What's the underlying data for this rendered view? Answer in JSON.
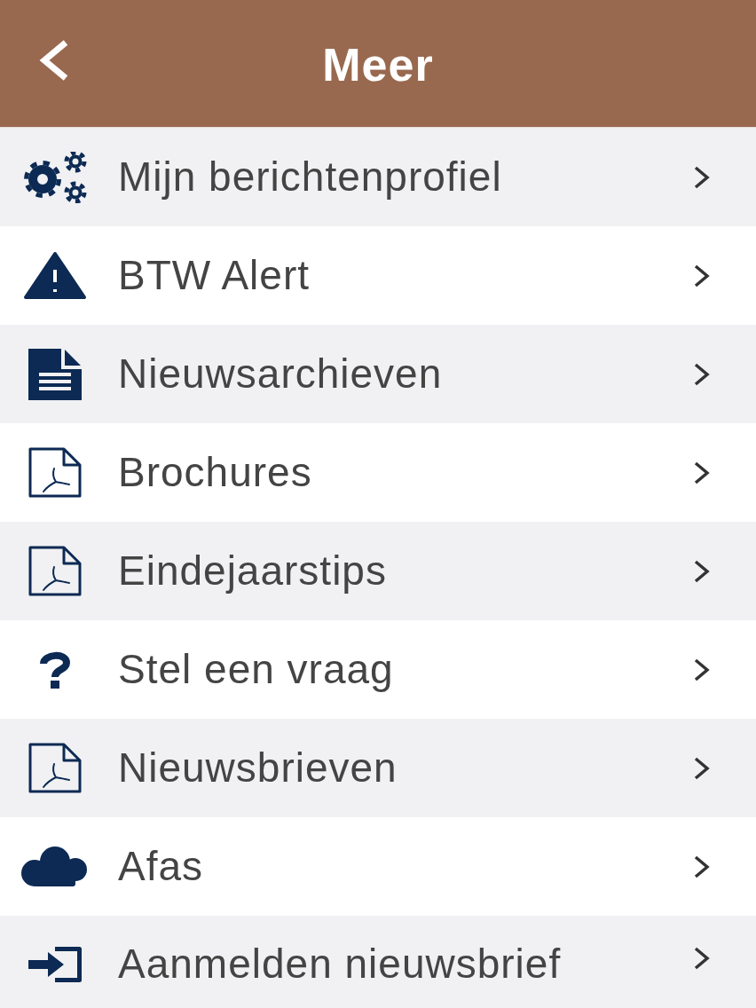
{
  "header": {
    "title": "Meer"
  },
  "menu": [
    {
      "kind": "gears",
      "label": "Mijn berichtenprofiel"
    },
    {
      "kind": "warning",
      "label": "BTW Alert"
    },
    {
      "kind": "document",
      "label": "Nieuwsarchieven"
    },
    {
      "kind": "pdf",
      "label": "Brochures"
    },
    {
      "kind": "pdf",
      "label": "Eindejaarstips"
    },
    {
      "kind": "question",
      "label": "Stel een vraag"
    },
    {
      "kind": "pdf",
      "label": "Nieuwsbrieven"
    },
    {
      "kind": "cloud",
      "label": "Afas"
    },
    {
      "kind": "sign-in",
      "label": "Aanmelden nieuwsbrief"
    }
  ]
}
